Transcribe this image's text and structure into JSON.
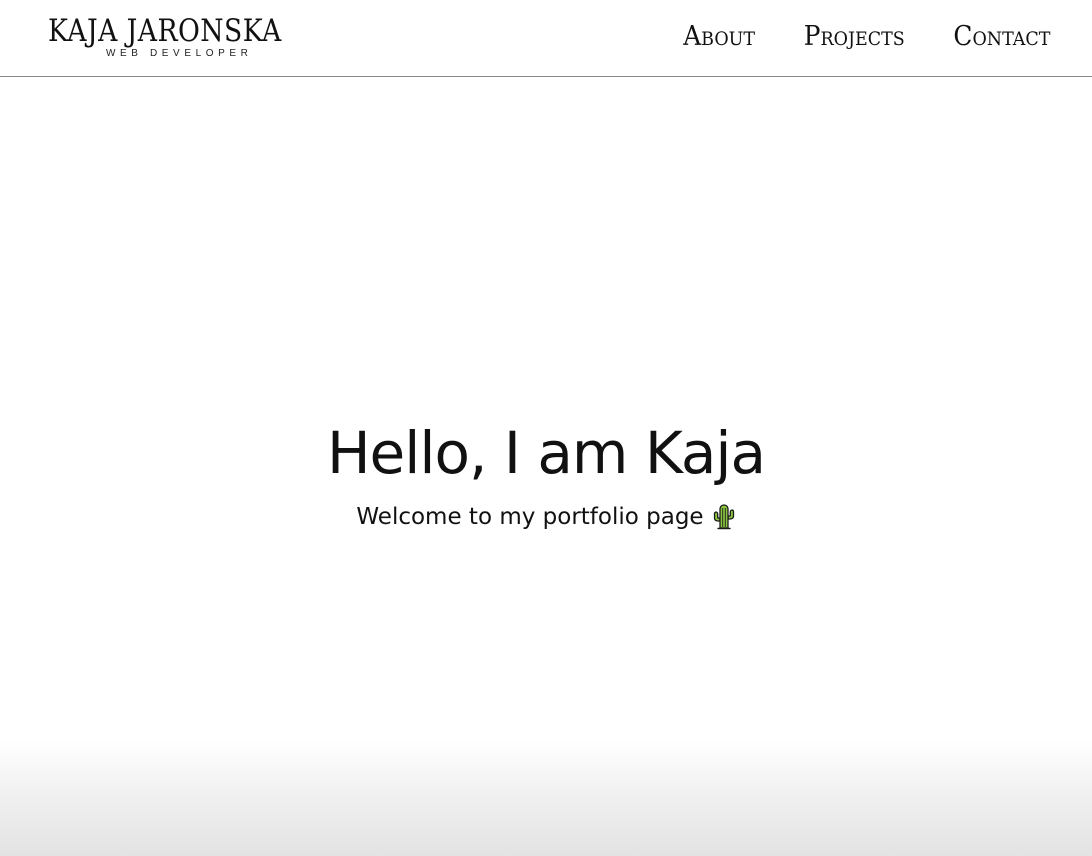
{
  "header": {
    "logo": {
      "name": "KAJA JARONSKA",
      "subtitle": "WEB DEVELOPER"
    },
    "nav": [
      {
        "label": "About"
      },
      {
        "label": "Projects"
      },
      {
        "label": "Contact"
      }
    ]
  },
  "hero": {
    "title": "Hello, I am Kaja",
    "subtitle": "Welcome to my portfolio page",
    "emoji_icon": "cactus-icon"
  },
  "colors": {
    "text": "#111111",
    "background": "#ffffff",
    "divider": "#8a8a8a",
    "cactus_green": "#8cc63f"
  }
}
